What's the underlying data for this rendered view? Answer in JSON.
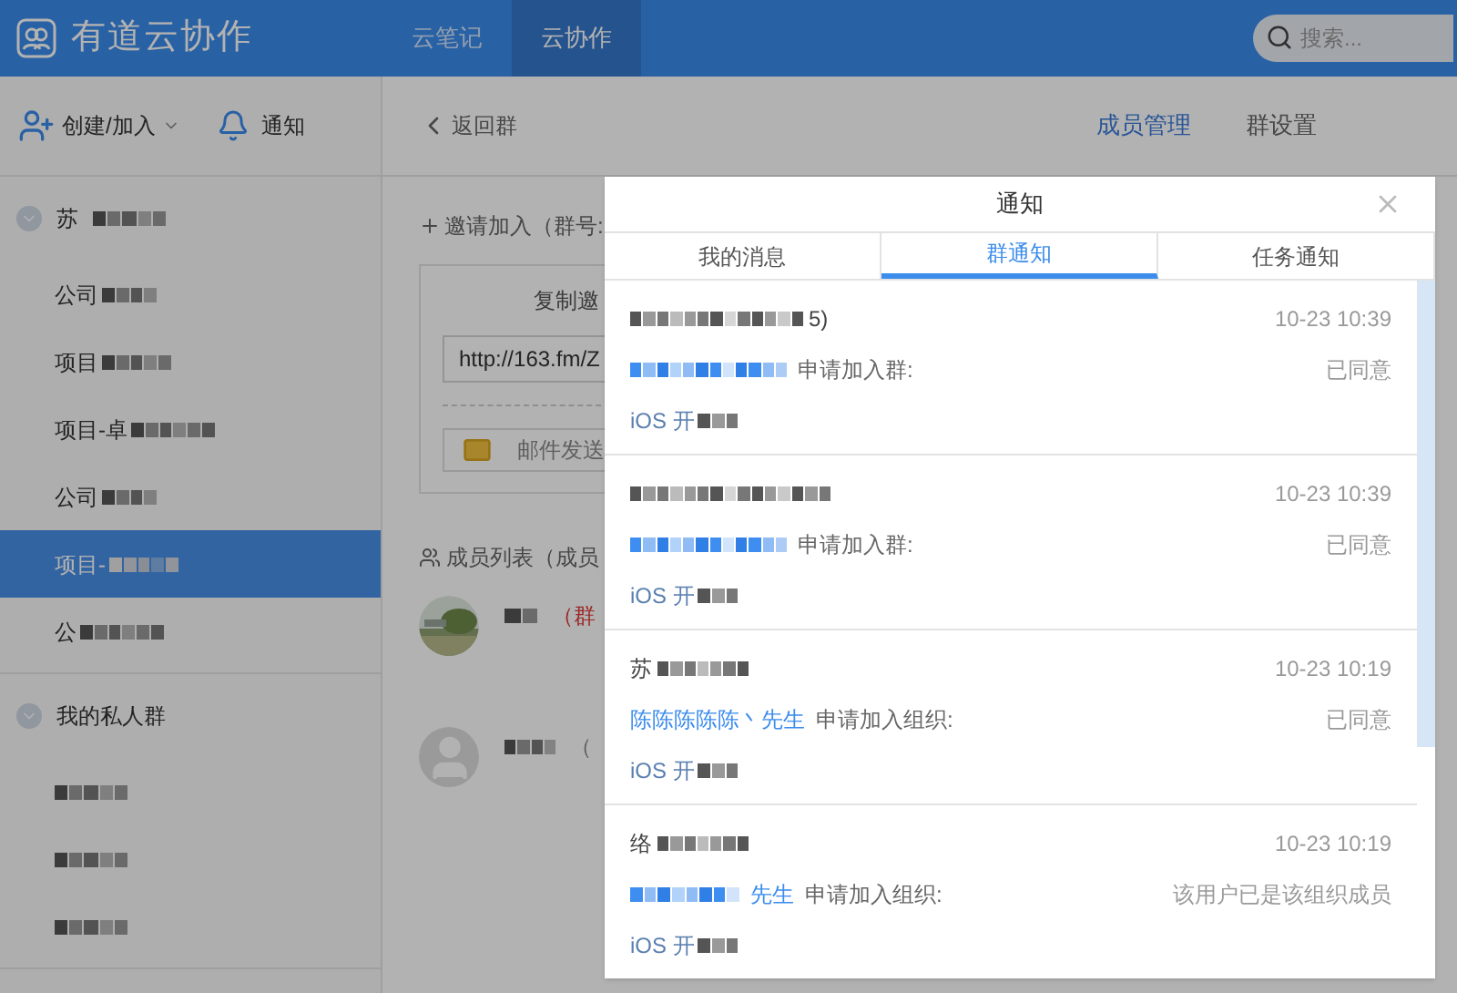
{
  "app": {
    "logo_text": "有道云协作"
  },
  "top_nav": [
    {
      "label": "云笔记",
      "selected": false
    },
    {
      "label": "云协作",
      "selected": true
    }
  ],
  "search": {
    "placeholder": "搜索..."
  },
  "sidebar": {
    "create_button": "创建/加入",
    "notify_button": "通知",
    "groups": [
      {
        "name": "苏",
        "expanded": true,
        "children": [
          {
            "name": "公司",
            "selected": false
          },
          {
            "name": "项目",
            "selected": false
          },
          {
            "name": "项目-卓",
            "selected": false
          },
          {
            "name": "公司",
            "selected": false
          },
          {
            "name": "项目-",
            "selected": true
          },
          {
            "name": "公",
            "selected": false
          }
        ]
      },
      {
        "name": "我的私人群",
        "expanded": true,
        "children": [
          {
            "selected": false
          },
          {
            "selected": false
          },
          {
            "selected": false
          }
        ]
      }
    ]
  },
  "main": {
    "back": "返回群",
    "tabs": [
      {
        "label": "成员管理",
        "selected": true
      },
      {
        "label": "群设置",
        "selected": false
      }
    ],
    "invite": {
      "label": "邀请加入（群号:",
      "copy_title": "复制邀",
      "url": "http://163.fm/Z",
      "email_button": "邮件发送"
    },
    "members": {
      "title": "成员列表（成员",
      "rows": [
        {
          "kind": "owner",
          "role": "（群"
        },
        {
          "kind": "editor",
          "role": "（"
        }
      ]
    }
  },
  "modal": {
    "title": "通知",
    "tabs": [
      {
        "label": "我的消息",
        "selected": false
      },
      {
        "label": "群通知",
        "selected": true
      },
      {
        "label": "任务通知",
        "selected": false
      }
    ],
    "items": [
      {
        "title": "5)",
        "time": "10-23 10:39",
        "action": "申请加入群:",
        "status": "已同意",
        "note": "iOS 开"
      },
      {
        "time": "10-23 10:39",
        "action": "申请加入群:",
        "status": "已同意",
        "note": "iOS 开"
      },
      {
        "title": "苏",
        "time": "10-23 10:19",
        "applicant": "陈陈陈陈陈丶先生",
        "action": "申请加入组织:",
        "status": "已同意",
        "note": "iOS 开"
      },
      {
        "title": "络",
        "time": "10-23 10:19",
        "applicant": "先生",
        "action": "申请加入组织:",
        "status": "该用户已是该组织成员",
        "note": "iOS 开"
      }
    ]
  }
}
